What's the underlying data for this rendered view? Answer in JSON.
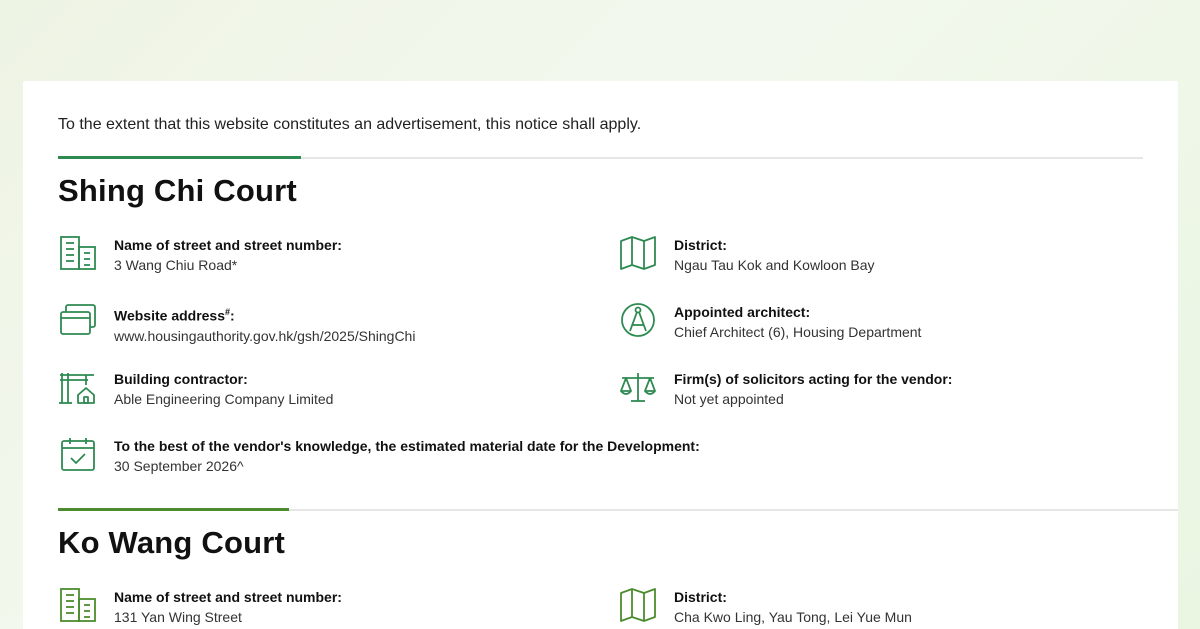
{
  "notice": "To the extent that this website constitutes an advertisement, this notice shall apply.",
  "colors": {
    "accent_green": "#2f8a52",
    "icon_green": "#2f8a52",
    "icon_olive": "#4d8c2e"
  },
  "sections": [
    {
      "title": "Shing Chi Court",
      "items": [
        {
          "icon": "building-icon",
          "label": "Name of street and street number:",
          "value": "3 Wang Chiu Road*"
        },
        {
          "icon": "map-icon",
          "label": "District:",
          "value": "Ngau Tau Kok and Kowloon Bay"
        },
        {
          "icon": "browser-window-icon",
          "label": "Website address",
          "label_sup": "#",
          "label_suffix": ":",
          "value": "www.housingauthority.gov.hk/gsh/2025/ShingChi"
        },
        {
          "icon": "compass-architect-icon",
          "label": "Appointed architect:",
          "value": "Chief Architect (6), Housing Department"
        },
        {
          "icon": "crane-contractor-icon",
          "label": "Building contractor:",
          "value": "Able Engineering Company Limited"
        },
        {
          "icon": "scales-icon",
          "label": "Firm(s) of solicitors acting for the vendor:",
          "value": "Not yet appointed"
        },
        {
          "icon": "calendar-check-icon",
          "label": "To the best of the vendor's knowledge, the estimated material date for the Development:",
          "value": "30 September 2026^"
        }
      ]
    },
    {
      "title": "Ko Wang Court",
      "items": [
        {
          "icon": "building-icon",
          "label": "Name of street and street number:",
          "value": "131 Yan Wing Street"
        },
        {
          "icon": "map-icon",
          "label": "District:",
          "value": "Cha Kwo Ling, Yau Tong, Lei Yue Mun"
        }
      ]
    }
  ]
}
